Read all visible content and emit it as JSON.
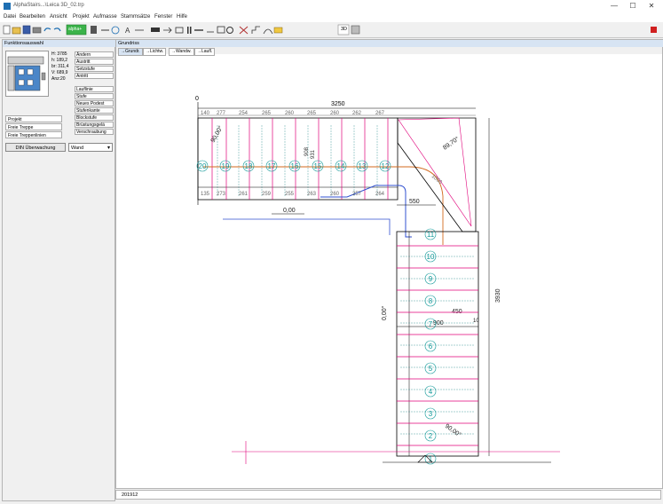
{
  "window": {
    "title": "AlphaStairs...\\Leica 3D_02.trp",
    "minimize": "—",
    "maximize": "☐",
    "close": "✕"
  },
  "menu": [
    "Datei",
    "Bearbeiten",
    "Ansicht",
    "Projekt",
    "Aufmasse",
    "Stammsätze",
    "Fenster",
    "Hilfe"
  ],
  "toolbar": {
    "alpha_label": "alpha+",
    "btn_3d": "3D"
  },
  "left_panel": {
    "title": "Funktionsauswahl",
    "stats": {
      "h": "H: 3785",
      "h2": "h: 189,2",
      "br": "br: 311,4",
      "v": "V: 689,9",
      "anz": "Anz:20"
    },
    "buttons1": [
      "Ändern",
      "Austritt",
      "Setzstufe",
      "Antritt"
    ],
    "buttons2": [
      "Lauflinie",
      "Stufe",
      "Neues Podest",
      "Stufenkante",
      "Blockstufe",
      "Brüstungsgelä",
      "Verschraubung"
    ],
    "projects": [
      "Projekt",
      "Freie Treppe",
      "Freie Treppenlinien"
    ],
    "din_button": "DIN Überwachung",
    "wand_select": "Wand"
  },
  "main": {
    "title": "Grundriss",
    "tabs": [
      "→Grundr.",
      "→Lichtw.",
      "→Wandw.",
      "→Laufl."
    ],
    "drawing": {
      "dim_top": "3250",
      "origin": "0",
      "top_widths": [
        "140",
        "277",
        "254",
        "265",
        "260",
        "265",
        "260",
        "262",
        "267"
      ],
      "bottom_widths": [
        "135",
        "273",
        "261",
        "259",
        "255",
        "263",
        "260",
        "257",
        "264"
      ],
      "steps_h": [
        "20",
        "19",
        "18",
        "17",
        "16",
        "15",
        "14",
        "13",
        "12"
      ],
      "steps_v": [
        "11",
        "10",
        "9",
        "8",
        "7",
        "6",
        "5",
        "4",
        "3",
        "2",
        "1"
      ],
      "angle1": "90,00°",
      "angle2": "89,70°",
      "angle3": "90,00°",
      "angle4": "0,00°",
      "dim_1000": "1000",
      "dim_550": "550",
      "dim_900": "900",
      "dim_450": "450",
      "dim_10": "10",
      "dim_zero": "0,00",
      "dim_right": "3930",
      "dim_908": "908",
      "dim_931": "931"
    }
  },
  "status": {
    "text": "201912"
  }
}
